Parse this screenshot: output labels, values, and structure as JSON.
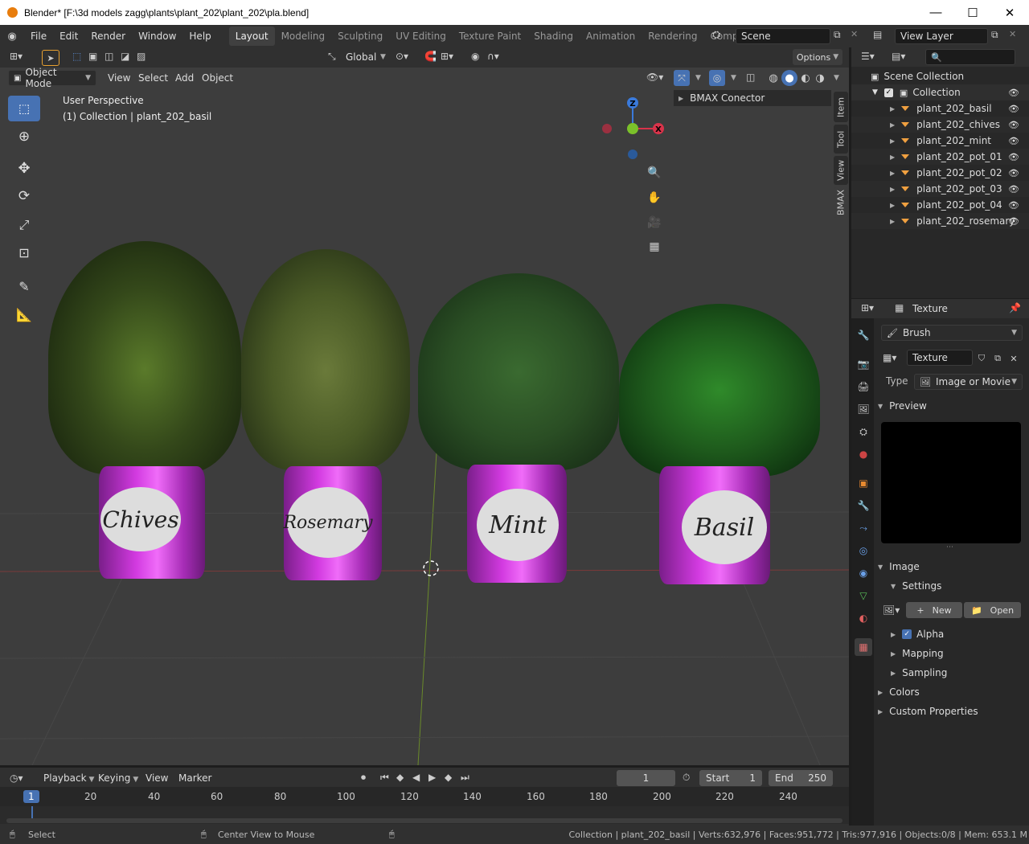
{
  "window": {
    "title": "Blender* [F:\\3d models zagg\\plants\\plant_202\\plant_202\\pla.blend]",
    "min": "—",
    "max": "☐",
    "close": "✕"
  },
  "menu": [
    "File",
    "Edit",
    "Render",
    "Window",
    "Help"
  ],
  "workspaces": [
    "Layout",
    "Modeling",
    "Sculpting",
    "UV Editing",
    "Texture Paint",
    "Shading",
    "Animation",
    "Rendering",
    "Compositing"
  ],
  "active_workspace": "Layout",
  "scene": {
    "name": "Scene",
    "view_layer": "View Layer"
  },
  "viewport_toolbar": {
    "orientation": "Global",
    "options": "Options"
  },
  "viewport_header": {
    "mode": "Object Mode",
    "menus": [
      "View",
      "Select",
      "Add",
      "Object"
    ]
  },
  "viewport_info": {
    "line1": "User Perspective",
    "line2": "(1) Collection | plant_202_basil"
  },
  "bmax": {
    "label": "BMAX Conector"
  },
  "side_tabs": [
    "Item",
    "Tool",
    "View",
    "BMAX"
  ],
  "gizmo": {
    "x": "X",
    "y": "Y",
    "z": "Z"
  },
  "pots": [
    "Chives",
    "Rosemary",
    "Mint",
    "Basil"
  ],
  "outliner": {
    "root": "Scene Collection",
    "collection": "Collection",
    "items": [
      "plant_202_basil",
      "plant_202_chives",
      "plant_202_mint",
      "plant_202_pot_01",
      "plant_202_pot_02",
      "plant_202_pot_03",
      "plant_202_pot_04",
      "plant_202_rosemary"
    ]
  },
  "properties": {
    "header": "Texture",
    "context": "Brush",
    "texture_name": "Texture",
    "type_label": "Type",
    "type_value": "Image or Movie",
    "preview": "Preview",
    "image": "Image",
    "settings": "Settings",
    "new": "New",
    "open": "Open",
    "alpha": "Alpha",
    "mapping": "Mapping",
    "sampling": "Sampling",
    "colors": "Colors",
    "custom": "Custom Properties"
  },
  "timeline": {
    "menus": [
      "Playback",
      "Keying",
      "View",
      "Marker"
    ],
    "current": "1",
    "start_label": "Start",
    "start": "1",
    "end_label": "End",
    "end": "250",
    "ticks": [
      "1",
      "20",
      "40",
      "60",
      "80",
      "100",
      "120",
      "140",
      "160",
      "180",
      "200",
      "220",
      "240"
    ]
  },
  "status": {
    "select": "Select",
    "center": "Center View to Mouse",
    "stats": "Collection | plant_202_basil | Verts:632,976 | Faces:951,772 | Tris:977,916 | Objects:0/8 | Mem: 653.1 M"
  }
}
